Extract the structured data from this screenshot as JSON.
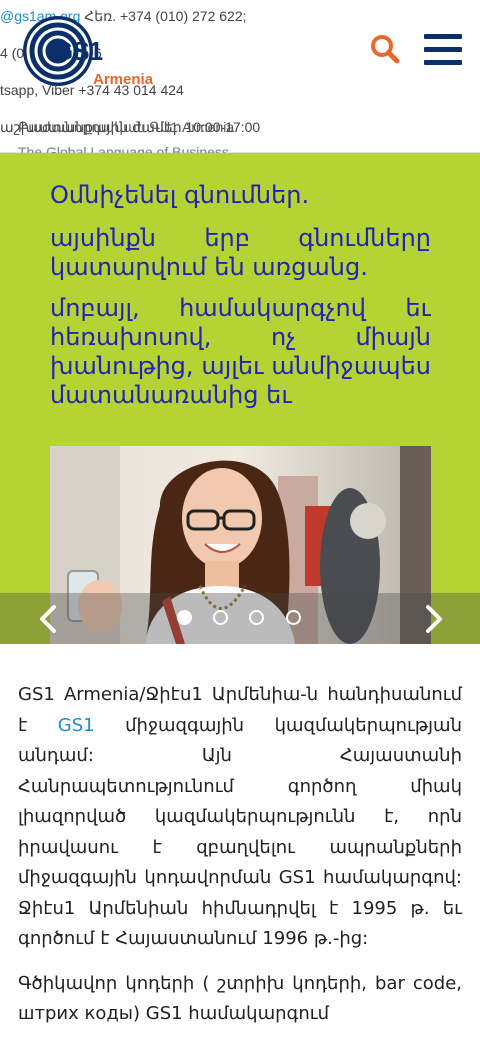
{
  "header": {
    "email_text": "@gs1am.org",
    "phone_label": " Հեռ. +374 (010) 272 622;",
    "phone2_text": "4 (0",
    "phone2_tail": "6",
    "whatsapp_text": "tsapp, Viber +374 43 014 424",
    "hours_text": "աշխատանքային ժամեր 10:00-17:00",
    "hours_overlay": "Բաժանորդական ԳՍ1 Armenia",
    "tagline": "The Global Language of Business",
    "logo_text": "GS1",
    "logo_country": "Armenia",
    "brand_blue": "#0b2f6a",
    "brand_orange": "#e9672b"
  },
  "hero": {
    "background": "#b5d334",
    "headline": "Օմնիչենել գնումներ.",
    "line2": "այսինքն երբ գնումները կատարվում են առցանց.",
    "line3": "մոբայլ, համակարգչով եւ հեռախոսով, ոչ միայն խանութից, այլեւ անմիջապես մատանառանից եւ",
    "slides_count": 4,
    "active_slide": 1
  },
  "about": {
    "p1_before_link": "GS1 Armenia/Ջիէս1 Արմենիա-ն հանդիսանում է ",
    "p1_link": "GS1",
    "p1_after_link": " միջազգային կազմակերպության անդամ: Այն Հայաստանի Հանրապետությունում գործող միակ լիազորված կազմակերպությունն է, որն իրավասու է զբաղվելու ապրանքների միջազգային կոդավորման GS1 համակարգով: Ջիէս1 Արմենիան հիմնադրվել է 1995 թ. եւ գործում է Հայաստանում 1996 թ.-ից:",
    "p2": "Գծիկավոր կոդերի ( շտրիխ կոդերի, bar code, штрих коды) GS1 համակարգում"
  }
}
